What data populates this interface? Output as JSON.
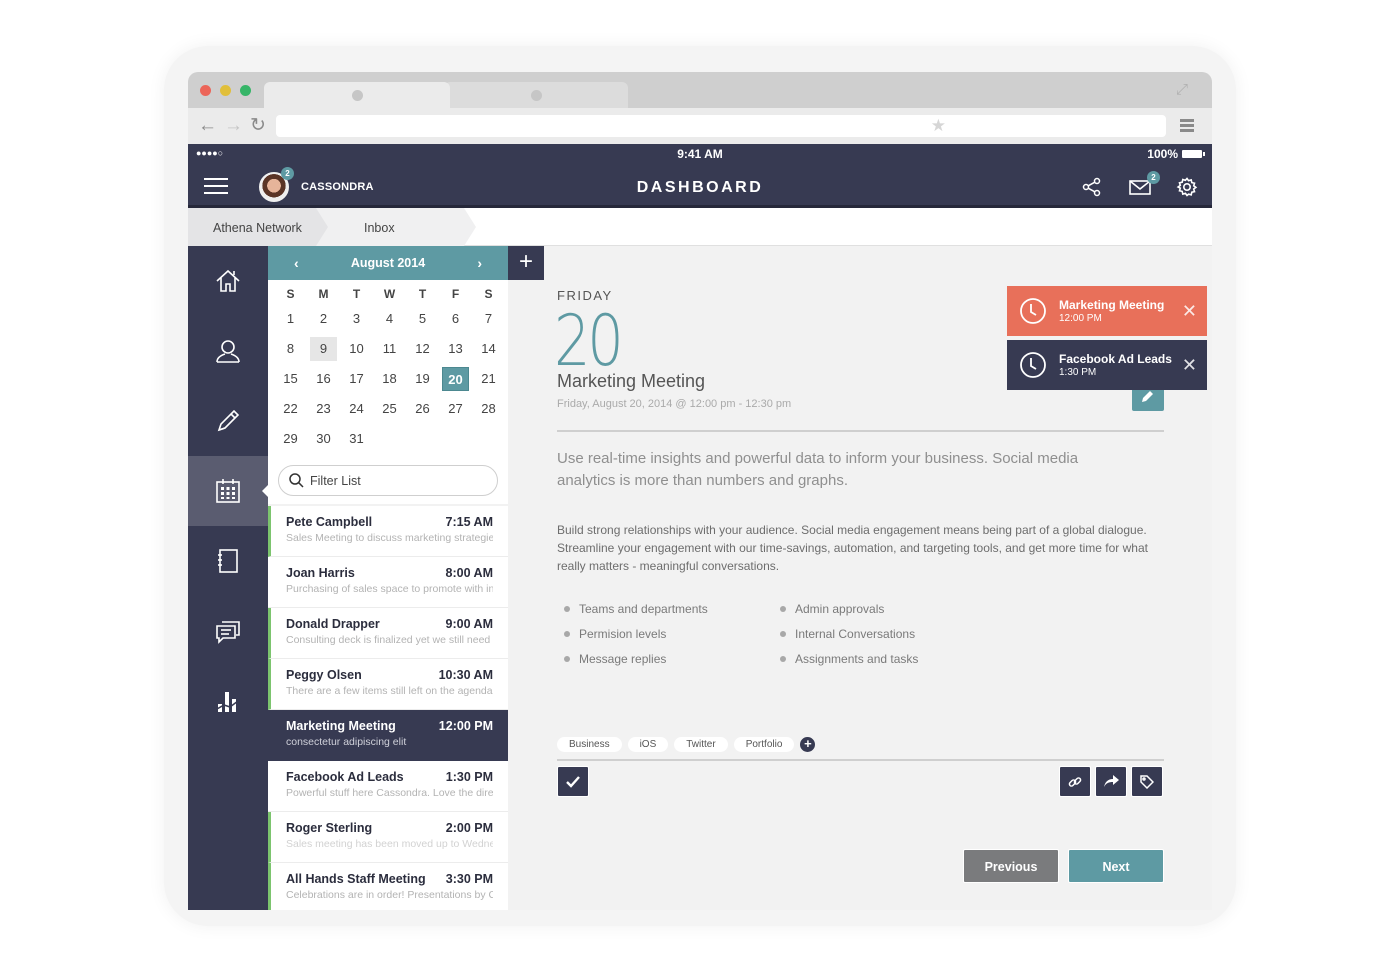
{
  "browser": {
    "tabs": [
      {
        "label": ""
      },
      {
        "label": ""
      }
    ],
    "url": ""
  },
  "status_bar": {
    "signal": "●●●●○",
    "time": "9:41 AM",
    "battery": "100%"
  },
  "header": {
    "username": "CASSONDRA",
    "avatar_badge": "2",
    "title": "DASHBOARD",
    "mail_badge": "2",
    "icons": [
      "menu-icon",
      "share-icon",
      "mail-icon",
      "gear-icon"
    ]
  },
  "breadcrumb": [
    {
      "label": "Athena Network"
    },
    {
      "label": "Inbox"
    }
  ],
  "sidebar": {
    "items": [
      {
        "icon": "home-icon",
        "label": "Home"
      },
      {
        "icon": "user-icon",
        "label": "Profile"
      },
      {
        "icon": "pencil-icon",
        "label": "Edit"
      },
      {
        "icon": "calendar-icon",
        "label": "Calendar",
        "active": true
      },
      {
        "icon": "notebook-icon",
        "label": "Notes"
      },
      {
        "icon": "chat-icon",
        "label": "Messages"
      },
      {
        "icon": "chart-icon",
        "label": "Analytics"
      }
    ]
  },
  "calendar": {
    "month_label": "August 2014",
    "prev_label": "‹",
    "next_label": "›",
    "add_label": "+",
    "weekdays": [
      "S",
      "M",
      "T",
      "W",
      "T",
      "F",
      "S"
    ],
    "days": [
      "1",
      "2",
      "3",
      "4",
      "5",
      "6",
      "7",
      "8",
      "9",
      "10",
      "11",
      "12",
      "13",
      "14",
      "15",
      "16",
      "17",
      "18",
      "19",
      "20",
      "21",
      "22",
      "23",
      "24",
      "25",
      "26",
      "27",
      "28",
      "29",
      "30",
      "31"
    ],
    "highlighted_day": "9",
    "selected_day": "20"
  },
  "filter": {
    "placeholder": "Filter List",
    "value": ""
  },
  "events": [
    {
      "name": "Pete Campbell",
      "time": "7:15 AM",
      "desc": "Sales Meeting to discuss marketing strategie",
      "accent": true
    },
    {
      "name": "Joan Harris",
      "time": "8:00 AM",
      "desc": "Purchasing of sales space to promote with in",
      "accent": false
    },
    {
      "name": "Donald Drapper",
      "time": "9:00 AM",
      "desc": "Consulting deck is finalized yet we still need",
      "accent": true
    },
    {
      "name": "Peggy Olsen",
      "time": "10:30 AM",
      "desc": "There are a few items still left on the agenda",
      "accent": true
    },
    {
      "name": "Marketing Meeting",
      "time": "12:00 PM",
      "desc": "consectetur adipiscing elit",
      "active": true
    },
    {
      "name": "Facebook Ad Leads",
      "time": "1:30 PM",
      "desc": "Powerful stuff here Cassondra. Love the dire",
      "accent": false
    },
    {
      "name": "Roger Sterling",
      "time": "2:00 PM",
      "desc": "Sales meeting has been moved up to Wedne",
      "accent": true
    },
    {
      "name": "All Hands Staff Meeting",
      "time": "3:30 PM",
      "desc": "Celebrations are in order! Presentations by C",
      "accent": true
    }
  ],
  "detail": {
    "day_name": "FRIDAY",
    "day_number": "20",
    "title": "Marketing Meeting",
    "datetime": "Friday, August 20, 2014 @ 12:00 pm - 12:30 pm",
    "lead": "Use real-time insights and powerful data to inform your business. Social media analytics is more than numbers and graphs.",
    "body": "Build strong relationships with your audience. Social media engagement means being part of a global dialogue. Streamline your engagement with our time-savings, automation, and targeting tools, and get more time for what really matters - meaningful conversations.",
    "bullets_left": [
      "Teams and departments",
      "Permision levels",
      "Message replies"
    ],
    "bullets_right": [
      "Admin approvals",
      "Internal Conversations",
      "Assignments and tasks"
    ],
    "tags": [
      "Business",
      "iOS",
      "Twitter",
      "Portfolio"
    ],
    "tag_add": "+",
    "previous_label": "Previous",
    "next_label": "Next"
  },
  "notifications": [
    {
      "title": "Marketing Meeting",
      "time": "12:00 PM",
      "color": "#e8705a"
    },
    {
      "title": "Facebook Ad Leads",
      "time": "1:30 PM",
      "color": "#373a52"
    }
  ],
  "colors": {
    "navy": "#373a52",
    "teal": "#5e9aa3",
    "orange": "#e8705a",
    "accent_green": "#7cc46e"
  }
}
